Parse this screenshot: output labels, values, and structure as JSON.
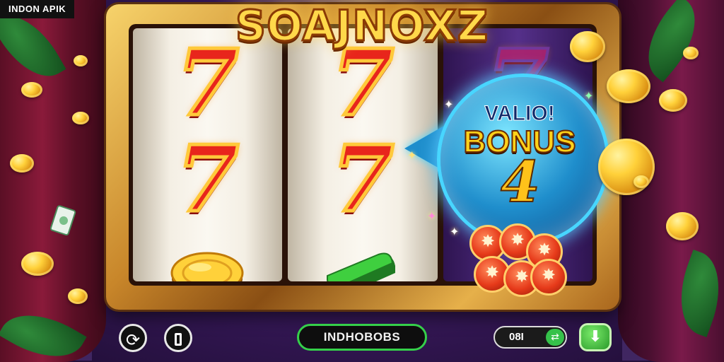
{
  "corner_badge": "INDON APIK",
  "game_title": "SOAJNOXZ",
  "bonus_bubble": {
    "line1": "VALIO!",
    "line2": "BONUS",
    "multiplier": "4"
  },
  "reels": {
    "symbol_seven": "7"
  },
  "controls": {
    "refresh_icon": "refresh-icon",
    "pause_icon": "pause-icon",
    "pill_label": "INDHOBOBS",
    "credit_value": "08I",
    "credit_button_icon": "arrows-icon",
    "go_button_icon": "down-arrow-icon"
  },
  "colors": {
    "accent_gold": "#ffd21a",
    "accent_green": "#35d04a",
    "bubble_blue": "#1f8ecc"
  }
}
